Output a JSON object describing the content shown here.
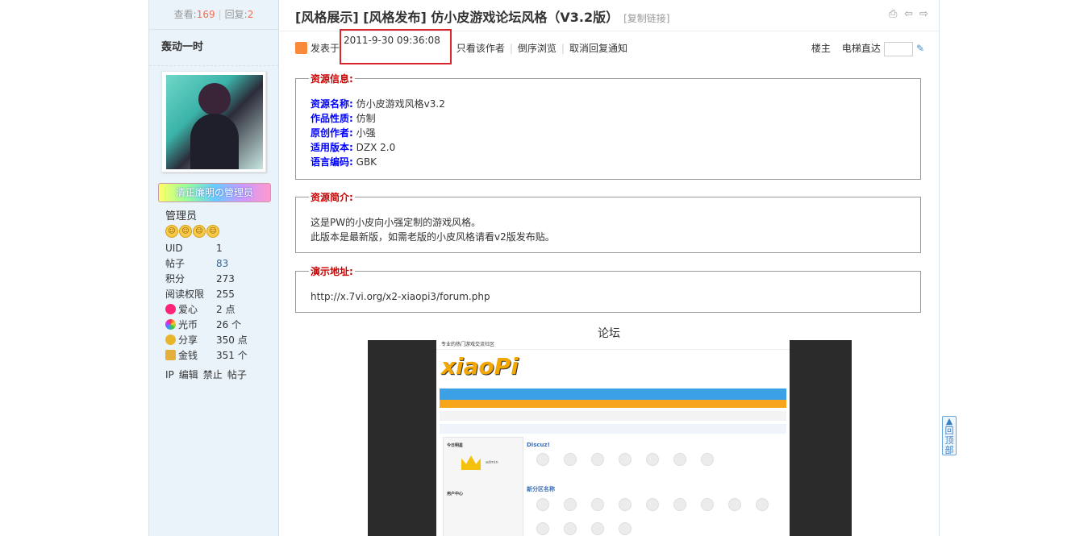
{
  "sidebar": {
    "views_label": "查看:",
    "views": "169",
    "replies_label": "回复:",
    "replies": "2",
    "author": "轰动一时",
    "badge": "清正廉明の管理员",
    "group": "管理员",
    "stats": [
      {
        "key": "UID",
        "value": "1"
      },
      {
        "key": "帖子",
        "value": "83"
      },
      {
        "key": "积分",
        "value": "273"
      },
      {
        "key": "阅读权限",
        "value": "255"
      },
      {
        "key": "爱心",
        "value": "2 点"
      },
      {
        "key": "光币",
        "value": "26 个"
      },
      {
        "key": "分享",
        "value": "350 点"
      },
      {
        "key": "金钱",
        "value": "351 个"
      }
    ],
    "actions": [
      "IP",
      "编辑",
      "禁止",
      "帖子"
    ]
  },
  "thread": {
    "title": "[风格展示] [风格发布] 仿小皮游戏论坛风格（V3.2版）",
    "copy_link": "[复制链接]"
  },
  "post": {
    "posted_label": "发表于",
    "date": "2011-9-30 09:36:08",
    "only_author": "只看该作者",
    "reverse": "倒序浏览",
    "cancel_notify": "取消回复通知",
    "floor": "楼主",
    "elevator": "电梯直达"
  },
  "resource_info": {
    "legend": "资源信息:",
    "rows": [
      {
        "label": "资源名称:",
        "value": "仿小皮游戏风格v3.2"
      },
      {
        "label": "作品性质:",
        "value": "仿制"
      },
      {
        "label": "原创作者:",
        "value": "小强"
      },
      {
        "label": "适用版本:",
        "value": "DZX 2.0"
      },
      {
        "label": "语言编码:",
        "value": "GBK"
      }
    ]
  },
  "resource_intro": {
    "legend": "资源简介:",
    "lines": [
      "这是PW的小皮向小强定制的游戏风格。",
      "此版本是最新版，如需老版的小皮风格请看v2版发布贴。"
    ]
  },
  "demo": {
    "legend": "演示地址:",
    "url": "http://x.7vi.org/x2-xiaopi3/forum.php"
  },
  "image_caption": "论坛",
  "screenshot": {
    "header": "专业的热门游戏交流社区",
    "logo": "xiaoPi",
    "section1": "Discuz!",
    "section2": "新分区名称",
    "user": "admin",
    "left_title": "今日明星",
    "user_center": "用户中心"
  },
  "gotop": "回顶部"
}
